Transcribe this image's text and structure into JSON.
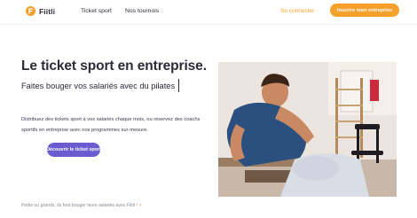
{
  "nav": {
    "logo_text": "Fiitli",
    "links": [
      "Ticket sport",
      "Nos tournois"
    ],
    "login": "Se connecter",
    "cta": "Inscrire mon entreprise"
  },
  "hero": {
    "title": "Le ticket sport en entreprise.",
    "subtitle": "Faites bouger vos salariés avec du pilates",
    "description": "Distribuez des tickets sport à vos salariés chaque mois, ou réservez des coachs sportifs en entreprise avec nos programmes sur-mesure.",
    "cta": "Découvrir le ticket sport"
  },
  "footer_note": "Petits ou grands, ils font bouger leurs salariés avec Fiitli !",
  "footer_icon": "lightning-bolt-emoji",
  "colors": {
    "accent_orange": "#f5a02a",
    "accent_purple": "#6a5bd1",
    "text_dark": "#2b2b3a"
  }
}
